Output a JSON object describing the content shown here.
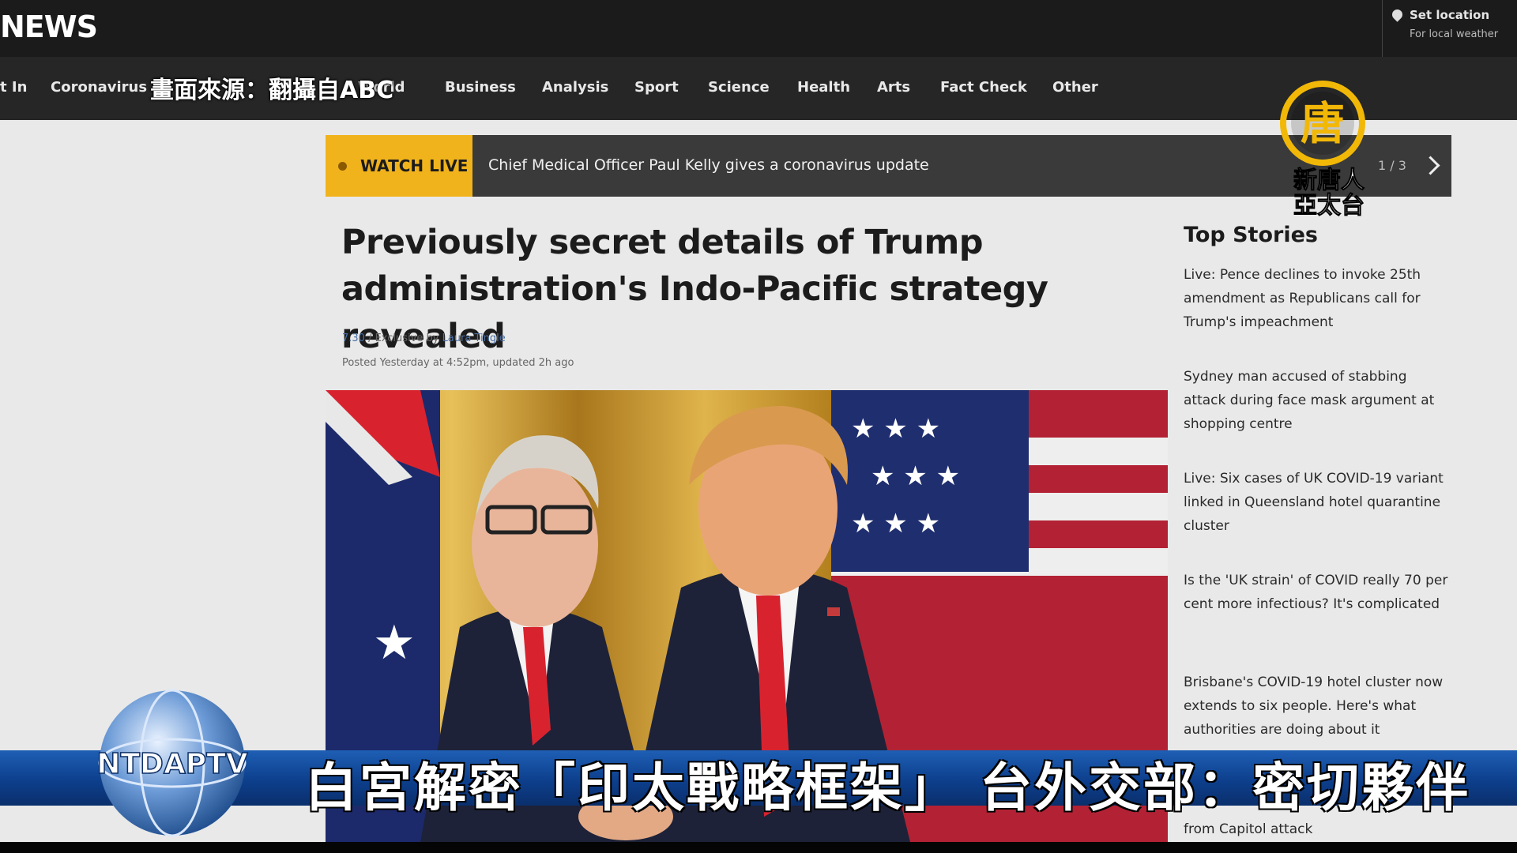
{
  "header": {
    "logo": "NEWS",
    "location": {
      "title": "Set location",
      "subtitle": "For local weather",
      "icon": "location-pin-icon"
    }
  },
  "nav": {
    "items": [
      "t In",
      "Coronavirus",
      "World",
      "Business",
      "Analysis",
      "Sport",
      "Science",
      "Health",
      "Arts",
      "Fact Check",
      "Other"
    ],
    "source_caption": "畫面來源：翻攝自ABC"
  },
  "watch_live": {
    "tag": "WATCH LIVE",
    "headline": "Chief Medical Officer Paul Kelly gives a coronavirus update",
    "pager": "1 / 3",
    "next_icon": "chevron-right-icon"
  },
  "article": {
    "title": "Previously secret details of Trump administration's Indo-Pacific strategy revealed",
    "program": "7.30",
    "byline_text": " / Exclusive by ",
    "author": "Laura Tingle",
    "posted": "Posted Yesterday at 4:52pm, updated 2h ago"
  },
  "top_stories": {
    "title": "Top Stories",
    "items": [
      "Live: Pence declines to invoke 25th amendment as Republicans call for Trump's impeachment",
      "Sydney man accused of stabbing attack during face mask argument at shopping centre",
      "Live: Six cases of UK COVID-19 variant linked in Queensland hotel quarantine cluster",
      "Is the 'UK strain' of COVID really 70 per cent more infectious? It's complicated",
      "Brisbane's COVID-19 hotel cluster now extends to six people. Here's what authorities are doing about it",
      "from Capitol attack"
    ]
  },
  "broadcast": {
    "watermark_glyph": "唐",
    "watermark_line1": "新唐人",
    "watermark_line2": "亞太台",
    "channel_logo": "NTDAPTV",
    "subtitle": "白宮解密「印太戰略框架」 台外交部：密切夥伴"
  },
  "colors": {
    "watch_live": "#f1b31c",
    "nav_bg": "#262626",
    "band_blue": "#0d3f8c",
    "tie_red": "#d8232f"
  }
}
